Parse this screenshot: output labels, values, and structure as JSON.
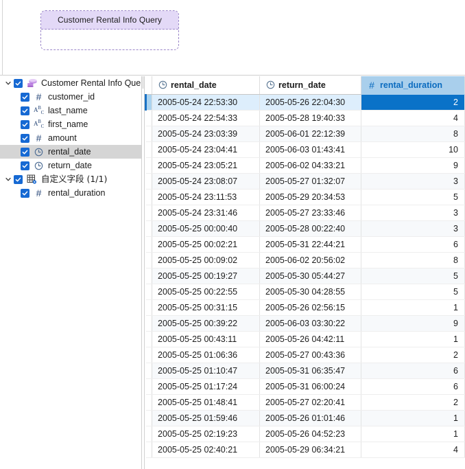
{
  "diagram": {
    "entity": {
      "title": "Customer Rental Info Query"
    }
  },
  "tree": {
    "root": {
      "label": "Customer Rental Info Quer",
      "icon": "query-layers-icon",
      "expanded": true,
      "checked": true
    },
    "fields": [
      {
        "label": "customer_id",
        "icon": "number-icon",
        "checked": true,
        "selected": false
      },
      {
        "label": "last_name",
        "icon": "text-icon",
        "checked": true,
        "selected": false
      },
      {
        "label": "first_name",
        "icon": "text-icon",
        "checked": true,
        "selected": false
      },
      {
        "label": "amount",
        "icon": "number-icon",
        "checked": true,
        "selected": false
      },
      {
        "label": "rental_date",
        "icon": "clock-icon",
        "checked": true,
        "selected": true
      },
      {
        "label": "return_date",
        "icon": "clock-icon",
        "checked": true,
        "selected": false
      }
    ],
    "custom_group": {
      "label": "自定义字段 (1/1)",
      "icon": "custom-fields-icon",
      "expanded": true,
      "checked": true
    },
    "custom_fields": [
      {
        "label": "rental_duration",
        "icon": "number-icon",
        "checked": true,
        "selected": false
      }
    ]
  },
  "grid": {
    "columns": [
      {
        "name": "rental_date",
        "icon": "clock-icon",
        "selected": false,
        "align": "left"
      },
      {
        "name": "return_date",
        "icon": "clock-icon",
        "selected": false,
        "align": "left"
      },
      {
        "name": "rental_duration",
        "icon": "number-icon",
        "selected": true,
        "align": "right"
      }
    ],
    "selected_row_index": 0,
    "rows": [
      {
        "rental_date": "2005-05-24 22:53:30",
        "return_date": "2005-05-26 22:04:30",
        "rental_duration": "2"
      },
      {
        "rental_date": "2005-05-24 22:54:33",
        "return_date": "2005-05-28 19:40:33",
        "rental_duration": "4"
      },
      {
        "rental_date": "2005-05-24 23:03:39",
        "return_date": "2005-06-01 22:12:39",
        "rental_duration": "8"
      },
      {
        "rental_date": "2005-05-24 23:04:41",
        "return_date": "2005-06-03 01:43:41",
        "rental_duration": "10"
      },
      {
        "rental_date": "2005-05-24 23:05:21",
        "return_date": "2005-06-02 04:33:21",
        "rental_duration": "9"
      },
      {
        "rental_date": "2005-05-24 23:08:07",
        "return_date": "2005-05-27 01:32:07",
        "rental_duration": "3"
      },
      {
        "rental_date": "2005-05-24 23:11:53",
        "return_date": "2005-05-29 20:34:53",
        "rental_duration": "5"
      },
      {
        "rental_date": "2005-05-24 23:31:46",
        "return_date": "2005-05-27 23:33:46",
        "rental_duration": "3"
      },
      {
        "rental_date": "2005-05-25 00:00:40",
        "return_date": "2005-05-28 00:22:40",
        "rental_duration": "3"
      },
      {
        "rental_date": "2005-05-25 00:02:21",
        "return_date": "2005-05-31 22:44:21",
        "rental_duration": "6"
      },
      {
        "rental_date": "2005-05-25 00:09:02",
        "return_date": "2005-06-02 20:56:02",
        "rental_duration": "8"
      },
      {
        "rental_date": "2005-05-25 00:19:27",
        "return_date": "2005-05-30 05:44:27",
        "rental_duration": "5"
      },
      {
        "rental_date": "2005-05-25 00:22:55",
        "return_date": "2005-05-30 04:28:55",
        "rental_duration": "5"
      },
      {
        "rental_date": "2005-05-25 00:31:15",
        "return_date": "2005-05-26 02:56:15",
        "rental_duration": "1"
      },
      {
        "rental_date": "2005-05-25 00:39:22",
        "return_date": "2005-06-03 03:30:22",
        "rental_duration": "9"
      },
      {
        "rental_date": "2005-05-25 00:43:11",
        "return_date": "2005-05-26 04:42:11",
        "rental_duration": "1"
      },
      {
        "rental_date": "2005-05-25 01:06:36",
        "return_date": "2005-05-27 00:43:36",
        "rental_duration": "2"
      },
      {
        "rental_date": "2005-05-25 01:10:47",
        "return_date": "2005-05-31 06:35:47",
        "rental_duration": "6"
      },
      {
        "rental_date": "2005-05-25 01:17:24",
        "return_date": "2005-05-31 06:00:24",
        "rental_duration": "6"
      },
      {
        "rental_date": "2005-05-25 01:48:41",
        "return_date": "2005-05-27 02:20:41",
        "rental_duration": "2"
      },
      {
        "rental_date": "2005-05-25 01:59:46",
        "return_date": "2005-05-26 01:01:46",
        "rental_duration": "1"
      },
      {
        "rental_date": "2005-05-25 02:19:23",
        "return_date": "2005-05-26 04:52:23",
        "rental_duration": "1"
      },
      {
        "rental_date": "2005-05-25 02:40:21",
        "return_date": "2005-05-29 06:34:21",
        "rental_duration": "4"
      }
    ]
  },
  "colors": {
    "accent_blue": "#0a72c8",
    "header_selected_bg": "#a9cfec",
    "entity_header_bg": "#e3d9f7",
    "checkbox_blue": "#1669d3",
    "tree_selection": "#d5d5d5"
  }
}
